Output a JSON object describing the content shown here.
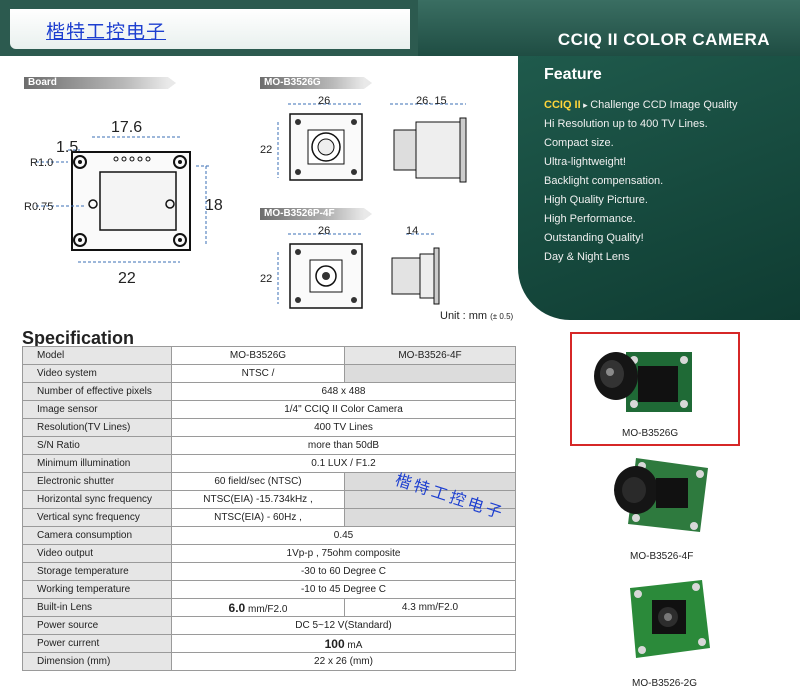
{
  "header": {
    "brand": "楷特工控电子",
    "title": "CCIQ II COLOR CAMERA"
  },
  "board": {
    "tag": "Board",
    "dim_top": "17.6",
    "dim_left": "1.5",
    "r1": "R1.0",
    "r075": "R0.75",
    "dim_height": "18",
    "dim_bottom": "22"
  },
  "model_a": {
    "tag": "MO-B3526G",
    "width": "26",
    "height": "22",
    "depth": "26. 15"
  },
  "model_b": {
    "tag": "MO-B3526P-4F",
    "width": "26",
    "height": "22",
    "depth": "14"
  },
  "unit": {
    "label": "Unit : mm",
    "tol": "(± 0.5)"
  },
  "feature": {
    "title": "Feature",
    "items": [
      {
        "hl": "CCIQ II",
        "text": "Challenge CCD Image Quality"
      },
      {
        "hl": "",
        "text": "Hi Resolution up to 400 TV Lines."
      },
      {
        "hl": "",
        "text": "Compact size."
      },
      {
        "hl": "",
        "text": "Ultra-lightweight!"
      },
      {
        "hl": "",
        "text": "Backlight compensation."
      },
      {
        "hl": "",
        "text": "High Quality Picrture."
      },
      {
        "hl": "",
        "text": "High Performance."
      },
      {
        "hl": "",
        "text": "Outstanding Quality!"
      },
      {
        "hl": "",
        "text": "Day & Night Lens"
      }
    ]
  },
  "spec": {
    "title": "Specification",
    "rows": [
      {
        "label": "Model",
        "a": "MO-B3526G",
        "b": "MO-B3526-4F"
      },
      {
        "label": "Video system",
        "a": "NTSC /",
        "b": ""
      },
      {
        "label": "Number  of  effective pixels",
        "a": "648 x 488",
        "b": null
      },
      {
        "label": "Image sensor",
        "a": "1/4\" CCIQ II Color Camera",
        "b": null
      },
      {
        "label": "Resolution(TV Lines)",
        "a": "400 TV Lines",
        "b": null
      },
      {
        "label": "S/N Ratio",
        "a": "more than 50dB",
        "b": null
      },
      {
        "label": "Minimum illumination",
        "a": "0.1 LUX / F1.2",
        "b": null
      },
      {
        "label": "Electronic shutter",
        "a": "60 field/sec (NTSC)",
        "b": ""
      },
      {
        "label": "Horizontal sync frequency",
        "a": "NTSC(EIA) -15.734kHz ,",
        "b": ""
      },
      {
        "label": "Vertical sync frequency",
        "a": "NTSC(EIA) - 60Hz ,",
        "b": ""
      },
      {
        "label": "Camera consumption",
        "a": "0.45",
        "b": null
      },
      {
        "label": "Video output",
        "a": "1Vp-p , 75ohm composite",
        "b": null
      },
      {
        "label": "Storage temperature",
        "a": "-30 to 60 Degree C",
        "b": null
      },
      {
        "label": "Working temperature",
        "a": "-10 to 45 Degree C",
        "b": null
      },
      {
        "label": "Built-in Lens",
        "a_big": "6.0",
        "a": " mm/F2.0",
        "b": "4.3 mm/F2.0"
      },
      {
        "label": "Power source",
        "a": "DC 5~12 V(Standard)",
        "b": null
      },
      {
        "label": "Power current",
        "a_big": "100",
        "a": " mA",
        "b": null
      },
      {
        "label": "Dimension (mm)",
        "a": "22 x 26 (mm)",
        "b": null
      }
    ]
  },
  "watermark2": "楷特工控电子",
  "photos": [
    {
      "caption": "MO-B3526G",
      "board_color": "#1f6a36"
    },
    {
      "caption": "MO-B3526-4F",
      "board_color": "#2e7a3e"
    },
    {
      "caption": "MO-B3526-2G",
      "board_color": "#2b8a3a"
    }
  ]
}
